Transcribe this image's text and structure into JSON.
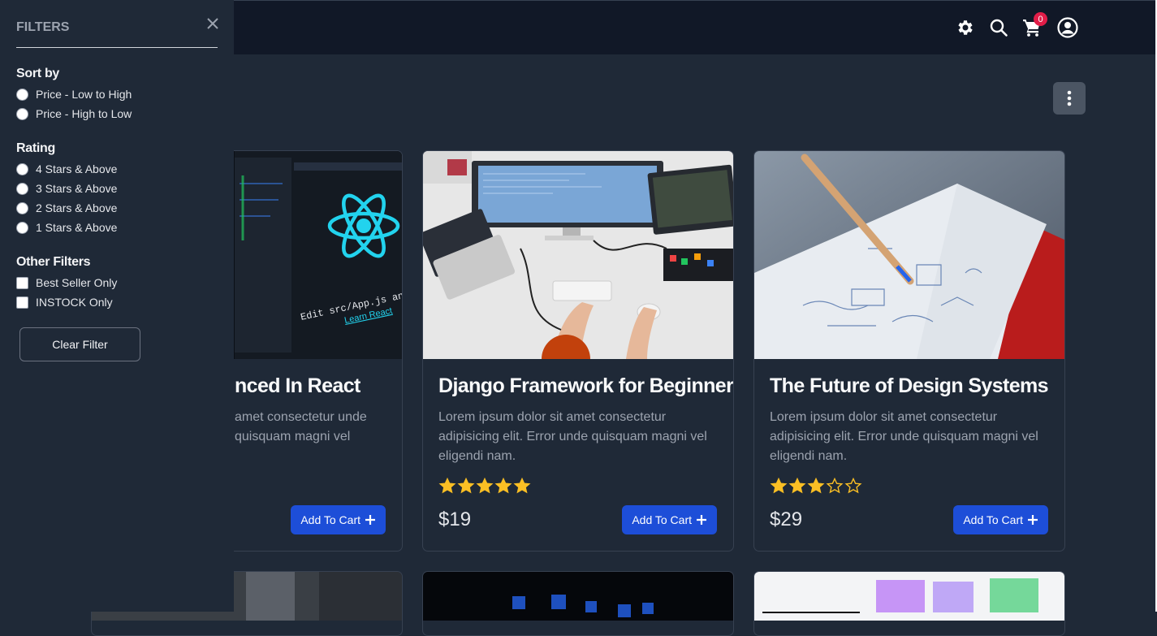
{
  "header": {
    "icons": [
      "gear-icon",
      "search-icon",
      "cart-icon",
      "account-icon"
    ],
    "cart_count": "0"
  },
  "filters": {
    "title": "FILTERS",
    "sort_by": {
      "heading": "Sort by",
      "options": [
        "Price - Low to High",
        "Price - High to Low"
      ]
    },
    "rating": {
      "heading": "Rating",
      "options": [
        "4 Stars & Above",
        "3 Stars & Above",
        "2 Stars & Above",
        "1 Stars & Above"
      ]
    },
    "other": {
      "heading": "Other Filters",
      "options": [
        "Best Seller Only",
        "INSTOCK Only"
      ]
    },
    "clear_label": "Clear Filter"
  },
  "products": [
    {
      "title": "nced In React",
      "desc": "amet consectetur unde quisquam magni vel",
      "button": "Add To Cart"
    },
    {
      "title": "Django Framework for Beginners",
      "desc": "Lorem ipsum dolor sit amet consectetur adipisicing elit. Error unde quisquam magni vel eligendi nam.",
      "rating": 5,
      "price": "$19",
      "button": "Add To Cart"
    },
    {
      "title": "The Future of Design Systems",
      "desc": "Lorem ipsum dolor sit amet consectetur adipisicing elit. Error unde quisquam magni vel eligendi nam.",
      "rating": 3,
      "price": "$29",
      "button": "Add To Cart"
    }
  ],
  "react_image_text": {
    "edit_line": "Edit src/App.js and save to reload.",
    "link": "Learn React"
  },
  "colors": {
    "header_bg": "#111827",
    "page_bg": "#1f2937",
    "accent": "#1d4ed8",
    "star": "#fbbf24",
    "badge": "#e11d48"
  }
}
